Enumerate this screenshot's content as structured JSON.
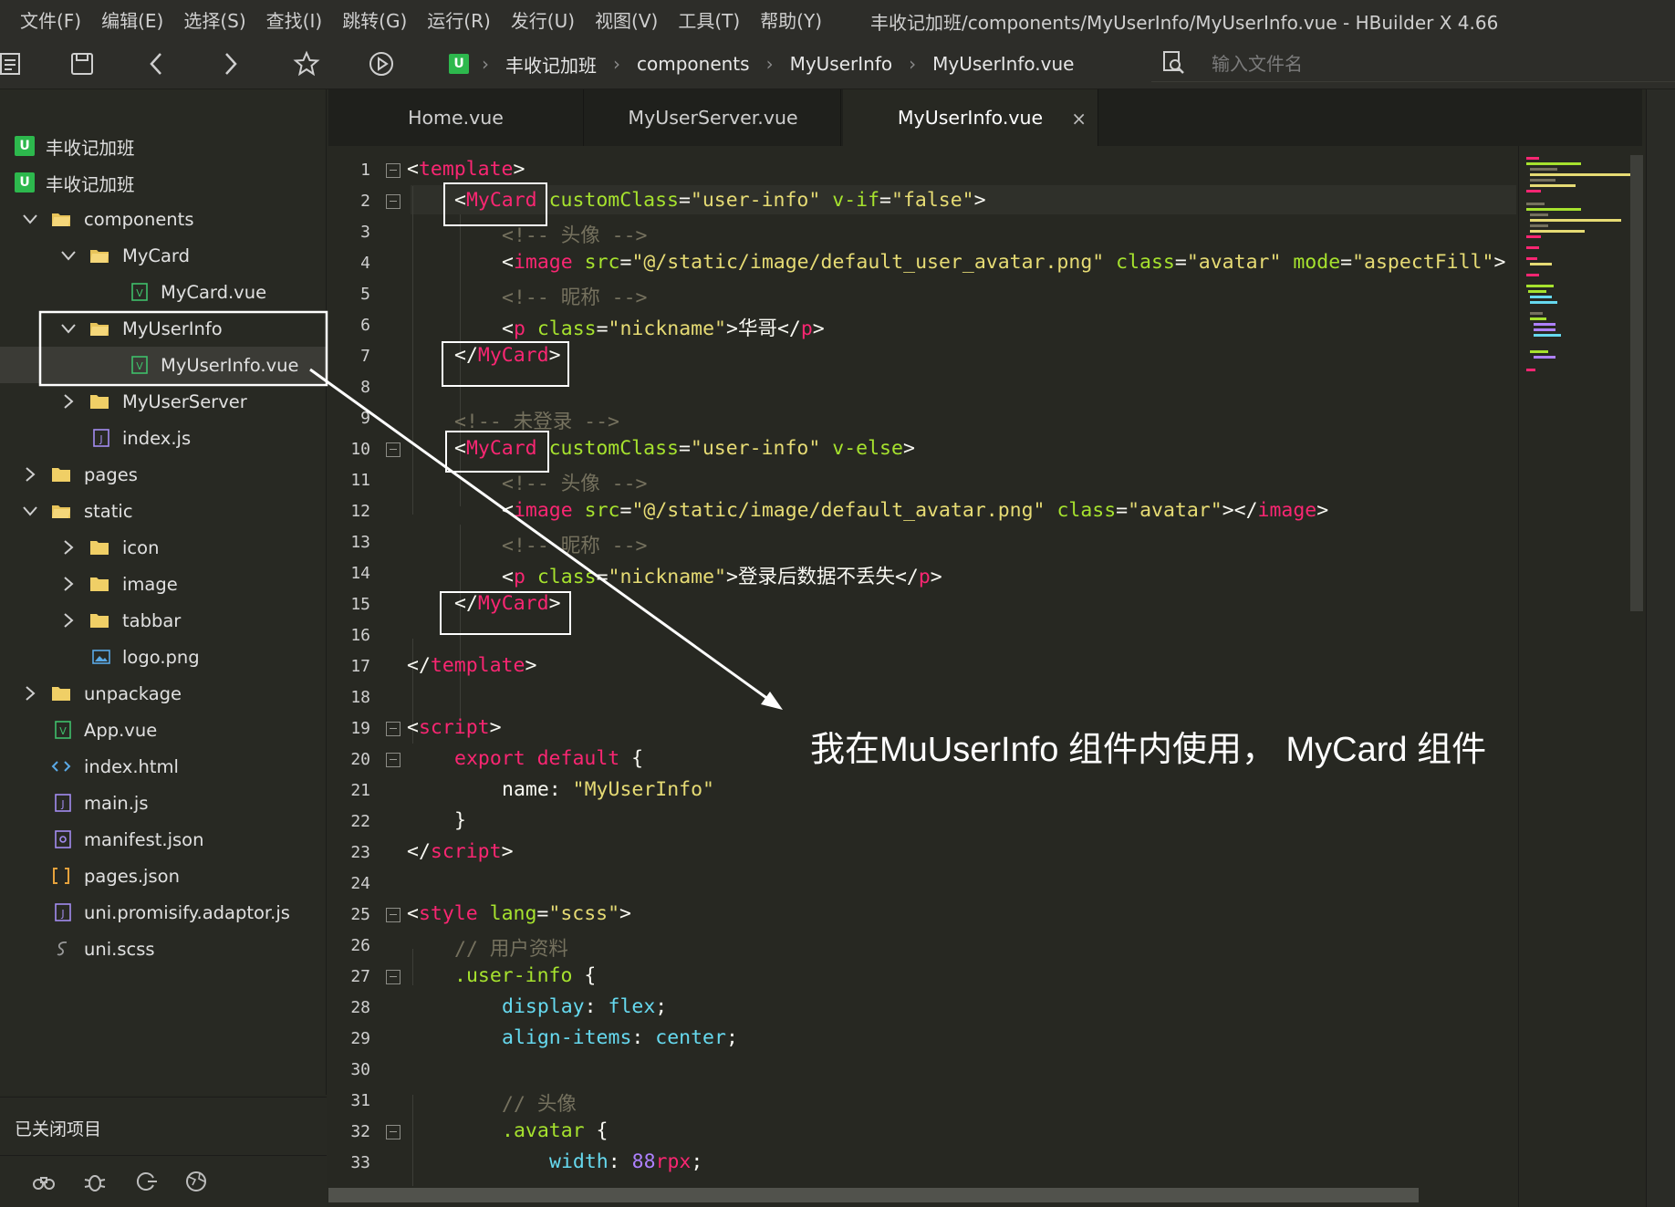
{
  "menu": [
    "文件(F)",
    "编辑(E)",
    "选择(S)",
    "查找(I)",
    "跳转(G)",
    "运行(R)",
    "发行(U)",
    "视图(V)",
    "工具(T)",
    "帮助(Y)"
  ],
  "window_title": "丰收记加班/components/MyUserInfo/MyUserInfo.vue - HBuilder X 4.66",
  "toolbar": {
    "icons": [
      "file-outline-icon",
      "save-icon",
      "back-arrow-icon",
      "forward-arrow-icon",
      "star-icon",
      "run-icon",
      "file-search-icon"
    ],
    "breadcrumb": [
      "丰收记加班",
      "components",
      "MyUserInfo",
      "MyUserInfo.vue"
    ],
    "search_placeholder": "输入文件名"
  },
  "sidebar": {
    "projects": [
      "丰收记加班",
      "丰收记加班"
    ],
    "tree": [
      {
        "label": "components",
        "icon": "folder-open-icon"
      },
      {
        "label": "MyCard",
        "icon": "folder-open-icon"
      },
      {
        "label": "MyCard.vue",
        "icon": "vue-file-icon"
      },
      {
        "label": "MyUserInfo",
        "icon": "folder-open-icon"
      },
      {
        "label": "MyUserInfo.vue",
        "icon": "vue-file-icon"
      },
      {
        "label": "MyUserServer",
        "icon": "folder-icon"
      },
      {
        "label": "index.js",
        "icon": "js-file-icon"
      },
      {
        "label": "pages",
        "icon": "folder-icon"
      },
      {
        "label": "static",
        "icon": "folder-open-icon"
      },
      {
        "label": "icon",
        "icon": "folder-icon"
      },
      {
        "label": "image",
        "icon": "folder-icon"
      },
      {
        "label": "tabbar",
        "icon": "folder-icon"
      },
      {
        "label": "logo.png",
        "icon": "image-file-icon"
      },
      {
        "label": "unpackage",
        "icon": "folder-icon"
      },
      {
        "label": "App.vue",
        "icon": "vue-file-icon"
      },
      {
        "label": "index.html",
        "icon": "html-file-icon"
      },
      {
        "label": "main.js",
        "icon": "js-file-icon"
      },
      {
        "label": "manifest.json",
        "icon": "manifest-file-icon"
      },
      {
        "label": "pages.json",
        "icon": "json-file-icon"
      },
      {
        "label": "uni.promisify.adaptor.js",
        "icon": "js-file-icon"
      },
      {
        "label": "uni.scss",
        "icon": "scss-file-icon"
      }
    ],
    "closed_projects": "已关闭项目"
  },
  "tabs": [
    "Home.vue",
    "MyUserServer.vue",
    "MyUserInfo.vue"
  ],
  "active_tab": "MyUserInfo.vue",
  "tab_close": "×",
  "line_numbers": [
    "1",
    "2",
    "3",
    "4",
    "5",
    "6",
    "7",
    "8",
    "9",
    "10",
    "11",
    "12",
    "13",
    "14",
    "15",
    "16",
    "17",
    "18",
    "19",
    "20",
    "21",
    "22",
    "23",
    "24",
    "25",
    "26",
    "27",
    "28",
    "29",
    "30",
    "31",
    "32",
    "33"
  ],
  "code": {
    "l1_open": "<",
    "l1_tag": "template",
    "l1_close": ">",
    "l2_open": "<",
    "l2_tag": "MyCard",
    "l2_attr1": "customClass",
    "l2_eq1": "=",
    "l2_val1": "\"user-info\"",
    "l2_attr2": "v-if",
    "l2_eq2": "=",
    "l2_val2": "\"false\"",
    "l2_close": ">",
    "l3": "<!-- 头像 -->",
    "l4_open": "<",
    "l4_tag": "image",
    "l4_attr1": "src",
    "l4_eq1": "=",
    "l4_val1": "\"@/static/image/default_user_avatar.png\"",
    "l4_attr2": "class",
    "l4_eq2": "=",
    "l4_val2": "\"avatar\"",
    "l4_attr3": "mode",
    "l4_eq3": "=",
    "l4_val3": "\"aspectFill\"",
    "l4_tail": ">",
    "l5": "<!-- 昵称 -->",
    "l6_open": "<",
    "l6_tag": "p",
    "l6_attr": "class",
    "l6_eq": "=",
    "l6_val": "\"nickname\"",
    "l6_text": ">华哥</",
    "l6_tag2": "p",
    "l6_close": ">",
    "l7_open": "</",
    "l7_tag": "MyCard",
    "l7_close": ">",
    "l9": "<!-- 未登录 -->",
    "l10_open": "<",
    "l10_tag": "MyCard",
    "l10_attr1": "customClass",
    "l10_eq1": "=",
    "l10_val1": "\"user-info\"",
    "l10_attr2": "v-else",
    "l10_close": ">",
    "l11": "<!-- 头像 -->",
    "l12_open": "<",
    "l12_tag": "image",
    "l12_attr1": "src",
    "l12_eq1": "=",
    "l12_val1": "\"@/static/image/default_avatar.png\"",
    "l12_attr2": "class",
    "l12_eq2": "=",
    "l12_val2": "\"avatar\"",
    "l12_mid": "></",
    "l12_tag2": "image",
    "l12_close": ">",
    "l13": "<!-- 昵称 -->",
    "l14_open": "<",
    "l14_tag": "p",
    "l14_attr": "class",
    "l14_eq": "=",
    "l14_val": "\"nickname\"",
    "l14_text": ">登录后数据不丢失</",
    "l14_tag2": "p",
    "l14_close": ">",
    "l15_open": "</",
    "l15_tag": "MyCard",
    "l15_close": ">",
    "l17_open": "</",
    "l17_tag": "template",
    "l17_close": ">",
    "l19_open": "<",
    "l19_tag": "script",
    "l19_close": ">",
    "l20_kw": "export default",
    "l20_rest": " {",
    "l21_key": "name",
    "l21_colon": ": ",
    "l21_val": "\"MyUserInfo\"",
    "l22": "}",
    "l23_open": "</",
    "l23_tag": "script",
    "l23_close": ">",
    "l25_open": "<",
    "l25_tag": "style",
    "l25_attr": "lang",
    "l25_eq": "=",
    "l25_val": "\"scss\"",
    "l25_close": ">",
    "l26": "// 用户资料",
    "l27_sel": ".user-info",
    "l27_rest": " {",
    "l28_prop": "display",
    "l28_colon": ": ",
    "l28_val": "flex",
    "l28_semi": ";",
    "l29_prop": "align-items",
    "l29_colon": ": ",
    "l29_val": "center",
    "l29_semi": ";",
    "l31": "// 头像",
    "l32_sel": ".avatar",
    "l32_rest": " {",
    "l33_prop": "width",
    "l33_colon": ": ",
    "l33_num": "88",
    "l33_unit": "rpx",
    "l33_semi": ";"
  },
  "annotation": "我在MuUserInfo 组件内使用， MyCard 组件",
  "colors": {
    "tag": "#f92672",
    "attr": "#a6e22e",
    "string": "#e6db74",
    "comment": "#75715e",
    "number": "#ae81ff",
    "property": "#66d9ef",
    "vue_badge": "#2db84d"
  }
}
